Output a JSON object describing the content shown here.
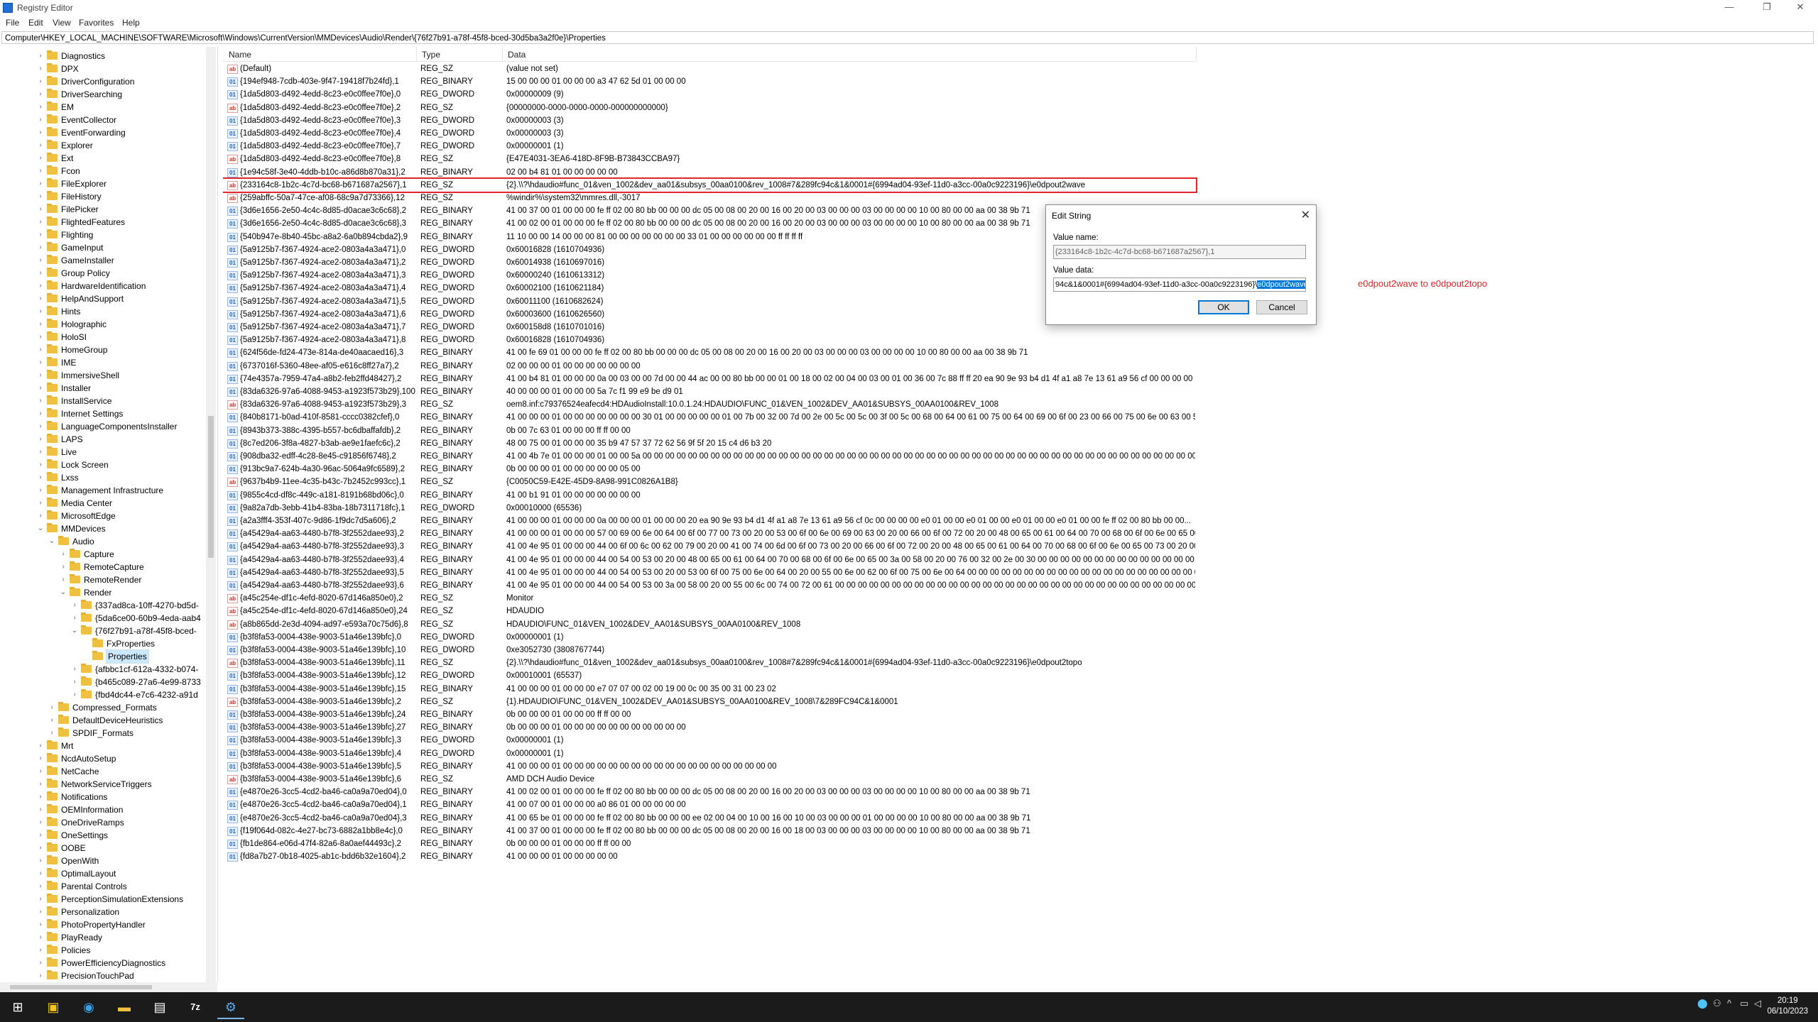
{
  "window": {
    "title": "Registry Editor",
    "minimize": "—",
    "maximize": "❐",
    "close": "✕"
  },
  "menu": [
    "File",
    "Edit",
    "View",
    "Favorites",
    "Help"
  ],
  "address": "Computer\\HKEY_LOCAL_MACHINE\\SOFTWARE\\Microsoft\\Windows\\CurrentVersion\\MMDevices\\Audio\\Render\\{76f27b91-a78f-45f8-bced-30d5ba3a2f0e}\\Properties",
  "tree": [
    {
      "label": "Diagnostics",
      "level": 0,
      "expandable": true
    },
    {
      "label": "DPX",
      "level": 0,
      "expandable": true
    },
    {
      "label": "DriverConfiguration",
      "level": 0,
      "expandable": true
    },
    {
      "label": "DriverSearching",
      "level": 0,
      "expandable": true
    },
    {
      "label": "EM",
      "level": 0,
      "expandable": true
    },
    {
      "label": "EventCollector",
      "level": 0,
      "expandable": true
    },
    {
      "label": "EventForwarding",
      "level": 0,
      "expandable": true
    },
    {
      "label": "Explorer",
      "level": 0,
      "expandable": true
    },
    {
      "label": "Ext",
      "level": 0,
      "expandable": true
    },
    {
      "label": "Fcon",
      "level": 0,
      "expandable": true
    },
    {
      "label": "FileExplorer",
      "level": 0,
      "expandable": true
    },
    {
      "label": "FileHistory",
      "level": 0,
      "expandable": true
    },
    {
      "label": "FilePicker",
      "level": 0,
      "expandable": true
    },
    {
      "label": "FlightedFeatures",
      "level": 0,
      "expandable": true
    },
    {
      "label": "Flighting",
      "level": 0,
      "expandable": true
    },
    {
      "label": "GameInput",
      "level": 0,
      "expandable": true
    },
    {
      "label": "GameInstaller",
      "level": 0,
      "expandable": true
    },
    {
      "label": "Group Policy",
      "level": 0,
      "expandable": true
    },
    {
      "label": "HardwareIdentification",
      "level": 0,
      "expandable": true
    },
    {
      "label": "HelpAndSupport",
      "level": 0,
      "expandable": true
    },
    {
      "label": "Hints",
      "level": 0,
      "expandable": true
    },
    {
      "label": "Holographic",
      "level": 0,
      "expandable": true
    },
    {
      "label": "HoloSI",
      "level": 0,
      "expandable": true
    },
    {
      "label": "HomeGroup",
      "level": 0,
      "expandable": true
    },
    {
      "label": "IME",
      "level": 0,
      "expandable": true
    },
    {
      "label": "ImmersiveShell",
      "level": 0,
      "expandable": true
    },
    {
      "label": "Installer",
      "level": 0,
      "expandable": true
    },
    {
      "label": "InstallService",
      "level": 0,
      "expandable": true
    },
    {
      "label": "Internet Settings",
      "level": 0,
      "expandable": true
    },
    {
      "label": "LanguageComponentsInstaller",
      "level": 0,
      "expandable": true
    },
    {
      "label": "LAPS",
      "level": 0,
      "expandable": true
    },
    {
      "label": "Live",
      "level": 0,
      "expandable": true
    },
    {
      "label": "Lock Screen",
      "level": 0,
      "expandable": true
    },
    {
      "label": "Lxss",
      "level": 0,
      "expandable": true
    },
    {
      "label": "Management Infrastructure",
      "level": 0,
      "expandable": true
    },
    {
      "label": "Media Center",
      "level": 0,
      "expandable": true
    },
    {
      "label": "MicrosoftEdge",
      "level": 0,
      "expandable": true
    },
    {
      "label": "MMDevices",
      "level": 0,
      "expandable": true,
      "expanded": true
    },
    {
      "label": "Audio",
      "level": 1,
      "expandable": true,
      "expanded": true
    },
    {
      "label": "Capture",
      "level": 2,
      "expandable": true
    },
    {
      "label": "RemoteCapture",
      "level": 2,
      "expandable": true
    },
    {
      "label": "RemoteRender",
      "level": 2,
      "expandable": true
    },
    {
      "label": "Render",
      "level": 2,
      "expandable": true,
      "expanded": true
    },
    {
      "label": "{337ad8ca-10ff-4270-bd5d-",
      "level": 3,
      "expandable": true
    },
    {
      "label": "{5da6ce00-60b9-4eda-aab4",
      "level": 3,
      "expandable": true
    },
    {
      "label": "{76f27b91-a78f-45f8-bced-",
      "level": 3,
      "expandable": true,
      "expanded": true
    },
    {
      "label": "FxProperties",
      "level": 4,
      "expandable": false
    },
    {
      "label": "Properties",
      "level": 4,
      "expandable": false,
      "selected": true
    },
    {
      "label": "{afbbc1cf-612a-4332-b074-",
      "level": 3,
      "expandable": true
    },
    {
      "label": "{b465c089-27a6-4e99-8733",
      "level": 3,
      "expandable": true
    },
    {
      "label": "{fbd4dc44-e7c6-4232-a91d",
      "level": 3,
      "expandable": true
    },
    {
      "label": "Compressed_Formats",
      "level": 1,
      "expandable": true
    },
    {
      "label": "DefaultDeviceHeuristics",
      "level": 1,
      "expandable": true
    },
    {
      "label": "SPDIF_Formats",
      "level": 1,
      "expandable": true
    },
    {
      "label": "Mrt",
      "level": 0,
      "expandable": true
    },
    {
      "label": "NcdAutoSetup",
      "level": 0,
      "expandable": true
    },
    {
      "label": "NetCache",
      "level": 0,
      "expandable": true
    },
    {
      "label": "NetworkServiceTriggers",
      "level": 0,
      "expandable": true
    },
    {
      "label": "Notifications",
      "level": 0,
      "expandable": true
    },
    {
      "label": "OEMInformation",
      "level": 0,
      "expandable": true
    },
    {
      "label": "OneDriveRamps",
      "level": 0,
      "expandable": true
    },
    {
      "label": "OneSettings",
      "level": 0,
      "expandable": true
    },
    {
      "label": "OOBE",
      "level": 0,
      "expandable": true
    },
    {
      "label": "OpenWith",
      "level": 0,
      "expandable": true
    },
    {
      "label": "OptimalLayout",
      "level": 0,
      "expandable": true
    },
    {
      "label": "Parental Controls",
      "level": 0,
      "expandable": true
    },
    {
      "label": "PerceptionSimulationExtensions",
      "level": 0,
      "expandable": true
    },
    {
      "label": "Personalization",
      "level": 0,
      "expandable": true
    },
    {
      "label": "PhotoPropertyHandler",
      "level": 0,
      "expandable": true
    },
    {
      "label": "PlayReady",
      "level": 0,
      "expandable": true
    },
    {
      "label": "Policies",
      "level": 0,
      "expandable": true
    },
    {
      "label": "PowerEfficiencyDiagnostics",
      "level": 0,
      "expandable": true
    },
    {
      "label": "PrecisionTouchPad",
      "level": 0,
      "expandable": true
    }
  ],
  "columns": {
    "name": "Name",
    "type": "Type",
    "data": "Data"
  },
  "values": [
    {
      "name": "(Default)",
      "type": "REG_SZ",
      "data": "(value not set)"
    },
    {
      "name": "{194ef948-7cdb-403e-9f47-19418f7b24fd},1",
      "type": "REG_BINARY",
      "data": "15 00 00 00 01 00 00 00 a3 47 62 5d 01 00 00 00"
    },
    {
      "name": "{1da5d803-d492-4edd-8c23-e0c0ffee7f0e},0",
      "type": "REG_DWORD",
      "data": "0x00000009 (9)"
    },
    {
      "name": "{1da5d803-d492-4edd-8c23-e0c0ffee7f0e},2",
      "type": "REG_SZ",
      "data": "{00000000-0000-0000-0000-000000000000}"
    },
    {
      "name": "{1da5d803-d492-4edd-8c23-e0c0ffee7f0e},3",
      "type": "REG_DWORD",
      "data": "0x00000003 (3)"
    },
    {
      "name": "{1da5d803-d492-4edd-8c23-e0c0ffee7f0e},4",
      "type": "REG_DWORD",
      "data": "0x00000003 (3)"
    },
    {
      "name": "{1da5d803-d492-4edd-8c23-e0c0ffee7f0e},7",
      "type": "REG_DWORD",
      "data": "0x00000001 (1)"
    },
    {
      "name": "{1da5d803-d492-4edd-8c23-e0c0ffee7f0e},8",
      "type": "REG_SZ",
      "data": "{E47E4031-3EA6-418D-8F9B-B73843CCBA97}"
    },
    {
      "name": "{1e94c58f-3e40-4ddb-b10c-a86d8b870a31},2",
      "type": "REG_BINARY",
      "data": "02 00 b4 81 01 00 00 00 00 00"
    },
    {
      "name": "{233164c8-1b2c-4c7d-bc68-b671687a2567},1",
      "type": "REG_SZ",
      "data": "{2}.\\\\?\\hdaudio#func_01&ven_1002&dev_aa01&subsys_00aa0100&rev_1008#7&289fc94c&1&0001#{6994ad04-93ef-11d0-a3cc-00a0c9223196}\\e0dpout2wave",
      "highlight": true
    },
    {
      "name": "{259abffc-50a7-47ce-af08-68c9a7d73366},12",
      "type": "REG_SZ",
      "data": "%windir%\\system32\\mmres.dll,-3017"
    },
    {
      "name": "{3d6e1656-2e50-4c4c-8d85-d0acae3c6c68},2",
      "type": "REG_BINARY",
      "data": "41 00 37 00 01 00 00 00 fe ff 02 00 80 bb 00 00 00 dc 05 00 08 00 20 00 16 00 20 00 03 00 00 00 03 00 00 00 00 10 00 80 00 00 aa 00 38 9b 71"
    },
    {
      "name": "{3d6e1656-2e50-4c4c-8d85-d0acae3c6c68},3",
      "type": "REG_BINARY",
      "data": "41 00 02 00 01 00 00 00 fe ff 02 00 80 bb 00 00 00 dc 05 00 08 00 20 00 16 00 20 00 03 00 00 00 03 00 00 00 00 10 00 80 00 00 aa 00 38 9b 71"
    },
    {
      "name": "{540b947e-8b40-45bc-a8a2-6a0b894cbda2},9",
      "type": "REG_BINARY",
      "data": "11 10 00 00 14 00 00 00 81 00 00 00 00 00 00 00 33 01 00 00 00 00 00 00 ff ff ff ff"
    },
    {
      "name": "{5a9125b7-f367-4924-ace2-0803a4a3a471},0",
      "type": "REG_DWORD",
      "data": "0x60016828 (1610704936)"
    },
    {
      "name": "{5a9125b7-f367-4924-ace2-0803a4a3a471},2",
      "type": "REG_DWORD",
      "data": "0x60014938 (1610697016)"
    },
    {
      "name": "{5a9125b7-f367-4924-ace2-0803a4a3a471},3",
      "type": "REG_DWORD",
      "data": "0x60000240 (1610613312)"
    },
    {
      "name": "{5a9125b7-f367-4924-ace2-0803a4a3a471},4",
      "type": "REG_DWORD",
      "data": "0x60002100 (1610621184)"
    },
    {
      "name": "{5a9125b7-f367-4924-ace2-0803a4a3a471},5",
      "type": "REG_DWORD",
      "data": "0x60011100 (1610682624)"
    },
    {
      "name": "{5a9125b7-f367-4924-ace2-0803a4a3a471},6",
      "type": "REG_DWORD",
      "data": "0x60003600 (1610626560)"
    },
    {
      "name": "{5a9125b7-f367-4924-ace2-0803a4a3a471},7",
      "type": "REG_DWORD",
      "data": "0x600158d8 (1610701016)"
    },
    {
      "name": "{5a9125b7-f367-4924-ace2-0803a4a3a471},8",
      "type": "REG_DWORD",
      "data": "0x60016828 (1610704936)"
    },
    {
      "name": "{624f56de-fd24-473e-814a-de40aacaed16},3",
      "type": "REG_BINARY",
      "data": "41 00 fe 69 01 00 00 00 fe ff 02 00 80 bb 00 00 00 dc 05 00 08 00 20 00 16 00 20 00 03 00 00 00 03 00 00 00 00 10 00 80 00 00 aa 00 38 9b 71"
    },
    {
      "name": "{6737016f-5360-48ee-af05-e616c8ff27a7},2",
      "type": "REG_BINARY",
      "data": "02 00 00 00 01 00 00 00 00 00 00 00"
    },
    {
      "name": "{74e4357a-7959-47a4-a8b2-feb2ffd48427},2",
      "type": "REG_BINARY",
      "data": "41 00 b4 81 01 00 00 00 0a 00 03 00 00 7d 00 00 44 ac 00 00 80 bb 00 00 01 00 18 00 02 00 04 00 03 00 01 00 36 00 7c 88 ff ff 20 ea 90 9e 93 b4 d1 4f a1 a8 7e 13 61 a9 56 cf 00 00 00 00 00 10..."
    },
    {
      "name": "{83da6326-97a6-4088-9453-a1923f573b29},100",
      "type": "REG_BINARY",
      "data": "40 00 00 00 01 00 00 00 5a 7c f1 99 e9 be d9 01"
    },
    {
      "name": "{83da6326-97a6-4088-9453-a1923f573b29},3",
      "type": "REG_SZ",
      "data": "oem8.inf:c79376524eafecd4:HDAudioInstall:10.0.1.24:HDAUDIO\\FUNC_01&VEN_1002&DEV_AA01&SUBSYS_00AA0100&REV_1008"
    },
    {
      "name": "{840b8171-b0ad-410f-8581-cccc0382cfef},0",
      "type": "REG_BINARY",
      "data": "41 00 00 00 01 00 00 00 00 00 00 00 30 01 00 00 00 00 00 01 00 7b 00 32 00 7d 00 2e 00 5c 00 5c 00 3f 00 5c 00 68 00 64 00 61 00 75 00 64 00 69 00 6f 00 23 00 66 00 75 00 6e 00 63 00 5f 00 30 00..."
    },
    {
      "name": "{8943b373-388c-4395-b557-bc6dbaffafdb},2",
      "type": "REG_BINARY",
      "data": "0b 00 7c 63 01 00 00 00 ff ff 00 00"
    },
    {
      "name": "{8c7ed206-3f8a-4827-b3ab-ae9e1faefc6c},2",
      "type": "REG_BINARY",
      "data": "48 00 75 00 01 00 00 00 35 b9 47 57 37 72 62 56 9f 5f 20 15 c4 d6 b3 20"
    },
    {
      "name": "{908dba32-edff-4c28-8e45-c91856f6748},2",
      "type": "REG_BINARY",
      "data": "41 00 4b 7e 01 00 00 00 01 00 00 5a 00 00 00 00 00 00 00 00 00 00 00 00 00 00 00 00 00 00 00 00 00 00 00 00 00 00 00 00 00 00 00 00 00 00 00 00 00 00 00 00 00 00 00 00 00 00 00 00 00..."
    },
    {
      "name": "{913bc9a7-624b-4a30-96ac-5064a9fc6589},2",
      "type": "REG_BINARY",
      "data": "0b 00 00 00 01 00 00 00 00 00 05 00"
    },
    {
      "name": "{9637b4b9-11ee-4c35-b43c-7b2452c993cc},1",
      "type": "REG_SZ",
      "data": "{C0050C59-E42E-45D9-8A98-991C0826A1B8}"
    },
    {
      "name": "{9855c4cd-df8c-449c-a181-8191b68bd06c},0",
      "type": "REG_BINARY",
      "data": "41 00 b1 91 01 00 00 00 00 00 00 00"
    },
    {
      "name": "{9a82a7db-3ebb-41b4-83ba-18b7311718fc},1",
      "type": "REG_DWORD",
      "data": "0x00010000 (65536)"
    },
    {
      "name": "{a2a3fff4-353f-407c-9d86-1f9dc7d5a606},2",
      "type": "REG_BINARY",
      "data": "41 00 00 00 01 00 00 00 0a 00 00 00 01 00 00 00 20 ea 90 9e 93 b4 d1 4f a1 a8 7e 13 61 a9 56 cf 0c 00 00 00 00 e0 01 00 00 e0 01 00 00 e0 01 00 00 e0 01 00 00 fe ff 02 00 80 bb 00 00..."
    },
    {
      "name": "{a45429a4-aa63-4480-b7f8-3f2552daee93},2",
      "type": "REG_BINARY",
      "data": "41 00 00 00 01 00 00 00 57 00 69 00 6e 00 64 00 6f 00 77 00 73 00 20 00 53 00 6f 00 6e 00 69 00 63 00 20 00 66 00 6f 00 72 00 20 00 48 00 65 00 61 00 64 00 70 00 68 00 6f 00 6e 00 65 00 73 00..."
    },
    {
      "name": "{a45429a4-aa63-4480-b7f8-3f2552daee93},3",
      "type": "REG_BINARY",
      "data": "41 00 4e 95 01 00 00 00 44 00 6f 00 6c 00 62 00 79 00 20 00 41 00 74 00 6d 00 6f 00 73 00 20 00 66 00 6f 00 72 00 20 00 48 00 65 00 61 00 64 00 70 00 68 00 6f 00 6e 00 65 00 73 00 20 00..."
    },
    {
      "name": "{a45429a4-aa63-4480-b7f8-3f2552daee93},4",
      "type": "REG_BINARY",
      "data": "41 00 4e 95 01 00 00 00 44 00 54 00 53 00 20 00 48 00 65 00 61 00 64 00 70 00 68 00 6f 00 6e 00 65 00 3a 00 58 00 20 00 76 00 32 00 2e 00 30 00 00 00 00 00 00 00 00 00 00 00 00 00 00 00..."
    },
    {
      "name": "{a45429a4-aa63-4480-b7f8-3f2552daee93},5",
      "type": "REG_BINARY",
      "data": "41 00 4e 95 01 00 00 00 44 00 54 00 53 00 20 00 53 00 6f 00 75 00 6e 00 64 00 20 00 55 00 6e 00 62 00 6f 00 75 00 6e 00 64 00 00 00 00 00 00 00 00 00 00 00 00 00 00 00 00 00 00 00 00 00..."
    },
    {
      "name": "{a45429a4-aa63-4480-b7f8-3f2552daee93},6",
      "type": "REG_BINARY",
      "data": "41 00 4e 95 01 00 00 00 44 00 54 00 53 00 3a 00 58 00 20 00 55 00 6c 00 74 00 72 00 61 00 00 00 00 00 00 00 00 00 00 00 00 00 00 00 00 00 00 00 00 00 00 00 00 00 00 00 00 00 00 00 00 00..."
    },
    {
      "name": "{a45c254e-df1c-4efd-8020-67d146a850e0},2",
      "type": "REG_SZ",
      "data": "Monitor"
    },
    {
      "name": "{a45c254e-df1c-4efd-8020-67d146a850e0},24",
      "type": "REG_SZ",
      "data": "HDAUDIO"
    },
    {
      "name": "{a8b865dd-2e3d-4094-ad97-e593a70c75d6},8",
      "type": "REG_SZ",
      "data": "HDAUDIO\\FUNC_01&VEN_1002&DEV_AA01&SUBSYS_00AA0100&REV_1008"
    },
    {
      "name": "{b3f8fa53-0004-438e-9003-51a46e139bfc},0",
      "type": "REG_DWORD",
      "data": "0x00000001 (1)"
    },
    {
      "name": "{b3f8fa53-0004-438e-9003-51a46e139bfc},10",
      "type": "REG_DWORD",
      "data": "0xe3052730 (3808767744)"
    },
    {
      "name": "{b3f8fa53-0004-438e-9003-51a46e139bfc},11",
      "type": "REG_SZ",
      "data": "{2}.\\\\?\\hdaudio#func_01&ven_1002&dev_aa01&subsys_00aa0100&rev_1008#7&289fc94c&1&0001#{6994ad04-93ef-11d0-a3cc-00a0c9223196}\\e0dpout2topo"
    },
    {
      "name": "{b3f8fa53-0004-438e-9003-51a46e139bfc},12",
      "type": "REG_DWORD",
      "data": "0x00010001 (65537)"
    },
    {
      "name": "{b3f8fa53-0004-438e-9003-51a46e139bfc},15",
      "type": "REG_BINARY",
      "data": "41 00 00 00 01 00 00 00 e7 07 07 00 02 00 19 00 0c 00 35 00 31 00 23 02"
    },
    {
      "name": "{b3f8fa53-0004-438e-9003-51a46e139bfc},2",
      "type": "REG_SZ",
      "data": "{1}.HDAUDIO\\FUNC_01&VEN_1002&DEV_AA01&SUBSYS_00AA0100&REV_1008\\7&289FC94C&1&0001"
    },
    {
      "name": "{b3f8fa53-0004-438e-9003-51a46e139bfc},24",
      "type": "REG_BINARY",
      "data": "0b 00 00 00 01 00 00 00 ff ff 00 00"
    },
    {
      "name": "{b3f8fa53-0004-438e-9003-51a46e139bfc},27",
      "type": "REG_BINARY",
      "data": "0b 00 00 00 01 00 00 00 00 00 00 00 00 00 00 00"
    },
    {
      "name": "{b3f8fa53-0004-438e-9003-51a46e139bfc},3",
      "type": "REG_DWORD",
      "data": "0x00000001 (1)"
    },
    {
      "name": "{b3f8fa53-0004-438e-9003-51a46e139bfc},4",
      "type": "REG_DWORD",
      "data": "0x00000001 (1)"
    },
    {
      "name": "{b3f8fa53-0004-438e-9003-51a46e139bfc},5",
      "type": "REG_BINARY",
      "data": "41 00 00 00 01 00 00 00 00 00 00 00 00 00 00 00 00 00 00 00 00 00 00 00"
    },
    {
      "name": "{b3f8fa53-0004-438e-9003-51a46e139bfc},6",
      "type": "REG_SZ",
      "data": "AMD DCH Audio Device"
    },
    {
      "name": "{e4870e26-3cc5-4cd2-ba46-ca0a9a70ed04},0",
      "type": "REG_BINARY",
      "data": "41 00 02 00 01 00 00 00 fe ff 02 00 80 bb 00 00 00 dc 05 00 08 00 20 00 16 00 20 00 03 00 00 00 03 00 00 00 00 10 00 80 00 00 aa 00 38 9b 71"
    },
    {
      "name": "{e4870e26-3cc5-4cd2-ba46-ca0a9a70ed04},1",
      "type": "REG_BINARY",
      "data": "41 00 07 00 01 00 00 00 a0 86 01 00 00 00 00 00"
    },
    {
      "name": "{e4870e26-3cc5-4cd2-ba46-ca0a9a70ed04},3",
      "type": "REG_BINARY",
      "data": "41 00 65 be 01 00 00 00 fe ff 02 00 80 bb 00 00 00 ee 02 00 04 00 10 00 16 00 10 00 03 00 00 00 01 00 00 00 00 10 00 80 00 00 aa 00 38 9b 71"
    },
    {
      "name": "{f19f064d-082c-4e27-bc73-6882a1bb8e4c},0",
      "type": "REG_BINARY",
      "data": "41 00 37 00 01 00 00 00 fe ff 02 00 80 bb 00 00 00 dc 05 00 08 00 20 00 16 00 18 00 03 00 00 00 03 00 00 00 00 10 00 80 00 00 aa 00 38 9b 71"
    },
    {
      "name": "{fb1de864-e06d-47f4-82a6-8a0aef44493c},2",
      "type": "REG_BINARY",
      "data": "0b 00 00 00 01 00 00 00 ff ff 00 00"
    },
    {
      "name": "{fd8a7b27-0b18-4025-ab1c-bdd6b32e1604},2",
      "type": "REG_BINARY",
      "data": "41 00 00 00 01 00 00 00 00 00"
    }
  ],
  "dialog": {
    "title": "Edit String",
    "close": "✕",
    "value_name_label": "Value name:",
    "value_name": "{233164c8-1b2c-4c7d-bc68-b671687a2567},1",
    "value_data_label": "Value data:",
    "value_data_prefix": "94c&1&0001#{6994ad04-93ef-11d0-a3cc-00a0c9223196}\\",
    "value_data_selected": "e0dpout2wave",
    "ok": "OK",
    "cancel": "Cancel"
  },
  "annotation": "e0dpout2wave to e0dpout2topo",
  "taskbar": {
    "time": "20:19",
    "date": "06/10/2023",
    "apps": [
      {
        "name": "start-icon",
        "glyph": "⊞"
      },
      {
        "name": "sticky-app-icon",
        "glyph": "▣"
      },
      {
        "name": "edge-icon",
        "glyph": "◉"
      },
      {
        "name": "file-explorer-icon",
        "glyph": "▬"
      },
      {
        "name": "notepad-icon",
        "glyph": "▤"
      },
      {
        "name": "7zip-icon",
        "glyph": "7z"
      },
      {
        "name": "regedit-icon",
        "glyph": "⚙"
      }
    ]
  },
  "colors": {
    "highlight_border": "#e0262a",
    "selection": "#0078d7",
    "annotation": "#e0262a"
  }
}
